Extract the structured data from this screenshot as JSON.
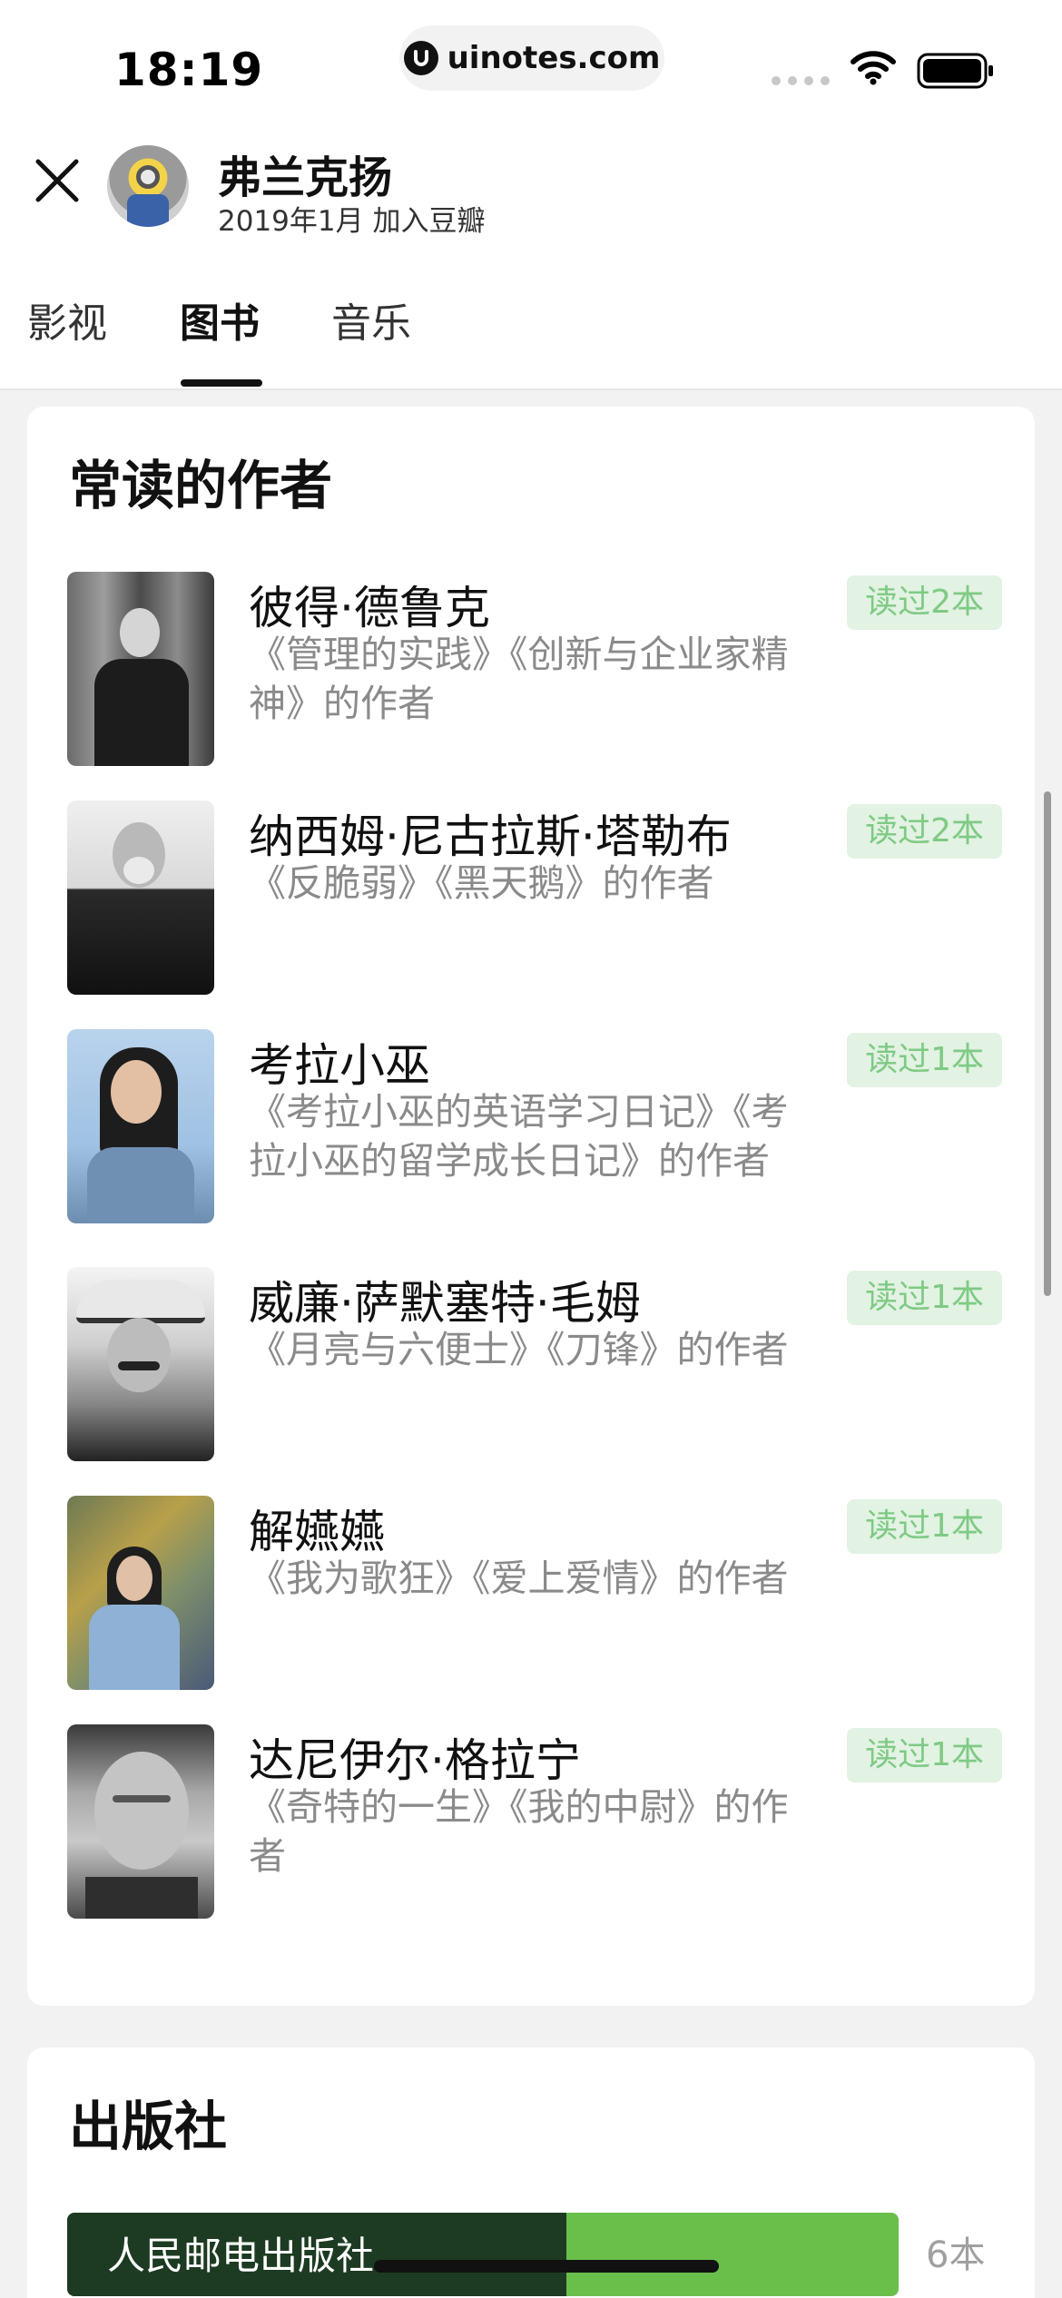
{
  "status_bar": {
    "time": "18:19",
    "url": "uinotes.com"
  },
  "header": {
    "user_name": "弗兰克扬",
    "join_text": "2019年1月 加入豆瓣"
  },
  "tabs": [
    {
      "label": "影视",
      "active": false
    },
    {
      "label": "图书",
      "active": true
    },
    {
      "label": "音乐",
      "active": false
    }
  ],
  "authors_section": {
    "title": "常读的作者",
    "items": [
      {
        "name": "彼得·德鲁克",
        "books": "《管理的实践》《创新与企业家精神》的作者",
        "badge": "读过2本"
      },
      {
        "name": "纳西姆·尼古拉斯·塔勒布",
        "books": "《反脆弱》《黑天鹅》的作者",
        "badge": "读过2本"
      },
      {
        "name": "考拉小巫",
        "books": "《考拉小巫的英语学习日记》《考拉小巫的留学成长日记》的作者",
        "badge": "读过1本"
      },
      {
        "name": "威廉·萨默塞特·毛姆",
        "books": "《月亮与六便士》《刀锋》的作者",
        "badge": "读过1本"
      },
      {
        "name": "解嬿嬿",
        "books": "《我为歌狂》《爱上爱情》的作者",
        "badge": "读过1本"
      },
      {
        "name": "达尼伊尔·格拉宁",
        "books": "《奇特的一生》《我的中尉》的作者",
        "badge": "读过1本"
      }
    ]
  },
  "publishers_section": {
    "title": "出版社",
    "items": [
      {
        "name": "人民邮电出版社",
        "count": "6本",
        "fraction": 0.6
      }
    ]
  },
  "colors": {
    "badge_bg": "#e2f2e3",
    "badge_text": "#7fca84",
    "publisher_bar_dark": "#1d3b22",
    "publisher_bar_light": "#6abf4b"
  }
}
